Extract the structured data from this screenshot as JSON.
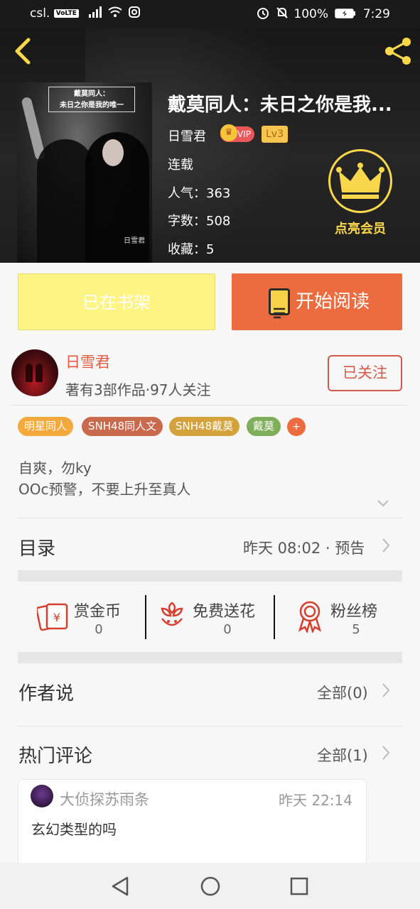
{
  "status_bar": {
    "carrier": "csl.",
    "volte": "VoLTE",
    "battery": "100%",
    "time": "7:29"
  },
  "book": {
    "title": "戴莫同人：未日之你是我...",
    "cover_title_line1": "戴莫同人：",
    "cover_title_line2": "未日之你是我的唯一",
    "cover_signature": "日雪君",
    "author": "日雪君",
    "vip_badge": "VIP",
    "level_badge": "Lv3",
    "status": "连载",
    "popularity_label": "人气：",
    "popularity": "363",
    "word_count_label": "字数：",
    "word_count": "508",
    "favorites_label": "收藏：",
    "favorites": "5"
  },
  "vip_promo": {
    "label": "点亮会员"
  },
  "actions": {
    "shelf_label": "已在书架",
    "read_label": "开始阅读"
  },
  "author_block": {
    "name": "日雪君",
    "info": "著有3部作品·97人关注",
    "follow_label": "已关注"
  },
  "tags": [
    {
      "label": "明星同人",
      "color": "#f4a93c"
    },
    {
      "label": "SNH48同人文",
      "color": "#c96a4f"
    },
    {
      "label": "SNH48戴莫",
      "color": "#d3a23a"
    },
    {
      "label": "戴莫",
      "color": "#7fae5a"
    }
  ],
  "tag_more": "+",
  "description": {
    "line1": "自爽，勿ky",
    "line2": "OOc预警，不要上升至真人"
  },
  "catalog": {
    "title": "目录",
    "latest": "昨天 08:02 · 预告"
  },
  "stats": [
    {
      "label": "赏金币",
      "value": "0",
      "icon": "coin-envelope-icon"
    },
    {
      "label": "免费送花",
      "value": "0",
      "icon": "flower-icon"
    },
    {
      "label": "粉丝榜",
      "value": "5",
      "icon": "medal-icon"
    }
  ],
  "author_says": {
    "title": "作者说",
    "all_label": "全部(0)"
  },
  "hot_comments": {
    "title": "热门评论",
    "all_label": "全部(1)",
    "items": [
      {
        "user": "大侦探苏雨条",
        "time": "昨天 22:14",
        "text": "玄幻类型的吗"
      }
    ]
  },
  "colors": {
    "accent_orange": "#ec6b3f",
    "vip_gold": "#f9d74b",
    "shelf_yellow": "#fef484",
    "author_red": "#e2593b"
  }
}
